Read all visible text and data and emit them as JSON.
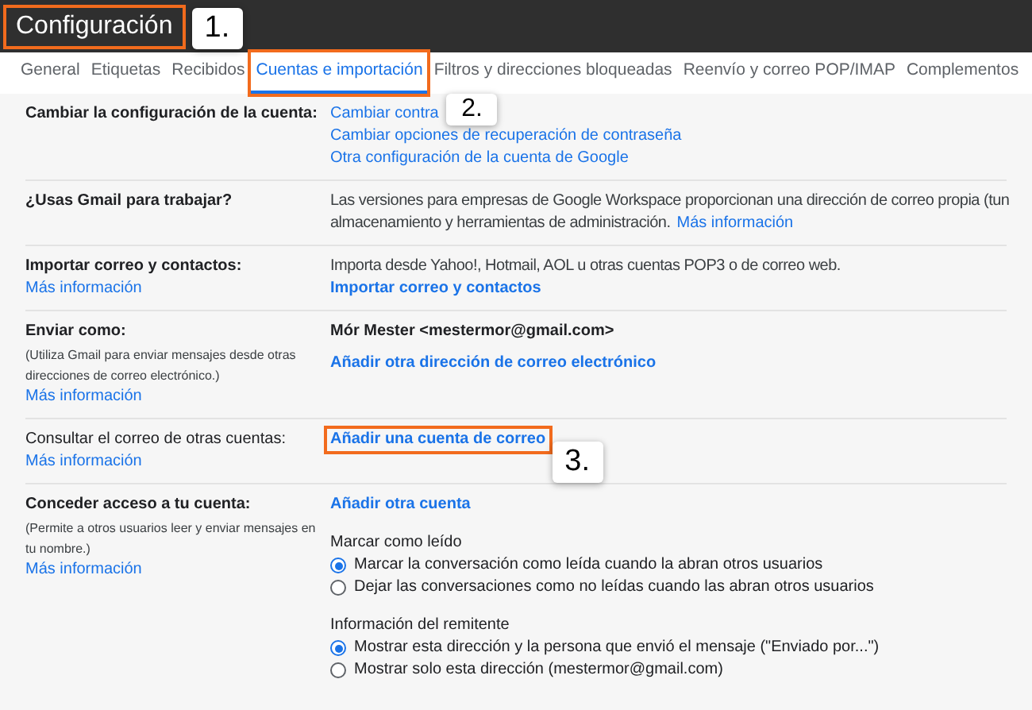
{
  "header": {
    "title": "Configuración",
    "highlighted": true,
    "step": "1."
  },
  "tabs": [
    {
      "label": "General",
      "selected": false,
      "highlighted": false
    },
    {
      "label": "Etiquetas",
      "selected": false,
      "highlighted": false
    },
    {
      "label": "Recibidos",
      "selected": false,
      "highlighted": false
    },
    {
      "label": "Cuentas e importación",
      "selected": true,
      "highlighted": true,
      "step": "2."
    },
    {
      "label": "Filtros y direcciones bloqueadas",
      "selected": false,
      "highlighted": false
    },
    {
      "label": "Reenvío y correo POP/IMAP",
      "selected": false,
      "highlighted": false
    },
    {
      "label": "Complementos",
      "selected": false,
      "highlighted": false
    }
  ],
  "sections": [
    {
      "label": "Cambiar la configuración de la cuenta:",
      "bold_label": true,
      "items": [
        {
          "kind": "link",
          "text": "Cambiar contra"
        },
        {
          "kind": "link",
          "text": "Cambiar opciones de recuperación de contraseña"
        },
        {
          "kind": "link",
          "text": "Otra configuración de la cuenta de Google"
        }
      ]
    },
    {
      "label": "¿Usas Gmail para trabajar?",
      "bold_label": true,
      "items": [
        {
          "kind": "text",
          "text": "Las versiones para empresas de Google Workspace proporcionan una dirección de correo propia (tun"
        },
        {
          "kind": "text_link",
          "text": "almacenamiento y herramientas de administración.",
          "link": "Más información"
        }
      ]
    },
    {
      "label": "Importar correo y contactos:",
      "bold_label": true,
      "more": "Más información",
      "items": [
        {
          "kind": "text",
          "text": "Importa desde Yahoo!, Hotmail, AOL u otras cuentas POP3 o de correo web."
        },
        {
          "kind": "action",
          "text": "Importar correo y contactos",
          "highlighted": false
        }
      ]
    },
    {
      "label": "Enviar como:",
      "bold_label": true,
      "note": "(Utiliza Gmail para enviar mensajes desde otras direcciones de correo electrónico.)",
      "more": "Más información",
      "items": [
        {
          "kind": "strong",
          "text": "Mór Mester <mestermor@gmail.com>"
        },
        {
          "kind": "action",
          "text": "Añadir otra dirección de correo electrónico",
          "highlighted": false
        }
      ]
    },
    {
      "label": "Consultar el correo de otras cuentas:",
      "bold_label": false,
      "more": "Más información",
      "items": [
        {
          "kind": "action",
          "text": "Añadir una cuenta de correo",
          "highlighted": true,
          "step": "3."
        }
      ]
    },
    {
      "label": "Conceder acceso a tu cuenta:",
      "bold_label": true,
      "note": "(Permite a otros usuarios leer y enviar mensajes en tu nombre.)",
      "more": "Más información",
      "items": [
        {
          "kind": "action",
          "text": "Añadir otra cuenta",
          "highlighted": false
        },
        {
          "kind": "radio_group",
          "title": "Marcar como leído",
          "options": [
            {
              "label": "Marcar la conversación como leída cuando la abran otros usuarios",
              "selected": true
            },
            {
              "label": "Dejar las conversaciones como no leídas cuando las abran otros usuarios",
              "selected": false
            }
          ]
        },
        {
          "kind": "radio_group",
          "title": "Información del remitente",
          "options": [
            {
              "label": "Mostrar esta dirección y la persona que envió el mensaje (\"Enviado por...\")",
              "selected": true
            },
            {
              "label": "Mostrar solo esta dirección (mestermor@gmail.com)",
              "selected": false
            }
          ]
        }
      ]
    }
  ]
}
